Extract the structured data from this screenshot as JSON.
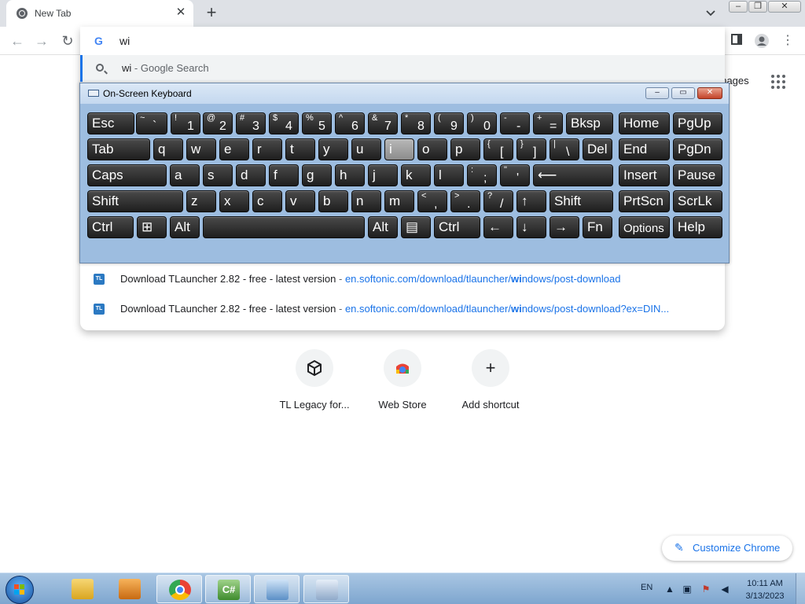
{
  "browser": {
    "tab_title": "New Tab",
    "tab_close": "✕",
    "new_tab": "+"
  },
  "omnibox": {
    "typed": "wi",
    "suggestion_query": "wi",
    "suggestion_suffix": "- Google Search",
    "results": [
      {
        "title": "Download TLauncher 2.82 - free - latest version",
        "sep": "-",
        "url_pre": "en.softonic.com/download/tlauncher/",
        "url_bold": "wi",
        "url_post": "ndows/post-download"
      },
      {
        "title": "Download TLauncher 2.82 - free - latest version",
        "sep": "-",
        "url_pre": "en.softonic.com/download/tlauncher/",
        "url_bold": "wi",
        "url_post": "ndows/post-download?ex=DIN..."
      }
    ]
  },
  "page": {
    "images_link": "Images",
    "shortcuts": [
      {
        "label": "TL Legacy for...",
        "icon": "cube-icon"
      },
      {
        "label": "Web Store",
        "icon": "web-store-icon"
      },
      {
        "label": "Add shortcut",
        "icon": "plus-icon"
      }
    ],
    "customize_label": "Customize Chrome"
  },
  "osk": {
    "title": "On-Screen Keyboard",
    "rows": [
      [
        {
          "label": "Esc"
        },
        {
          "shift": "~",
          "base": "`"
        },
        {
          "shift": "!",
          "base": "1"
        },
        {
          "shift": "@",
          "base": "2"
        },
        {
          "shift": "#",
          "base": "3"
        },
        {
          "shift": "$",
          "base": "4"
        },
        {
          "shift": "%",
          "base": "5"
        },
        {
          "shift": "^",
          "base": "6"
        },
        {
          "shift": "&",
          "base": "7"
        },
        {
          "shift": "*",
          "base": "8"
        },
        {
          "shift": "(",
          "base": "9"
        },
        {
          "shift": ")",
          "base": "0"
        },
        {
          "shift": "-",
          "base": "-"
        },
        {
          "shift": "+",
          "base": "="
        },
        {
          "label": "Bksp"
        },
        {
          "label": "Home"
        },
        {
          "label": "PgUp"
        }
      ],
      [
        {
          "label": "Tab"
        },
        {
          "label": "q"
        },
        {
          "label": "w"
        },
        {
          "label": "e"
        },
        {
          "label": "r"
        },
        {
          "label": "t"
        },
        {
          "label": "y"
        },
        {
          "label": "u"
        },
        {
          "label": "i"
        },
        {
          "label": "o"
        },
        {
          "label": "p"
        },
        {
          "shift": "{",
          "base": "["
        },
        {
          "shift": "}",
          "base": "]"
        },
        {
          "shift": "|",
          "base": "\\"
        },
        {
          "label": "Del"
        },
        {
          "label": "End"
        },
        {
          "label": "PgDn"
        }
      ],
      [
        {
          "label": "Caps"
        },
        {
          "label": "a"
        },
        {
          "label": "s"
        },
        {
          "label": "d"
        },
        {
          "label": "f"
        },
        {
          "label": "g"
        },
        {
          "label": "h"
        },
        {
          "label": "j"
        },
        {
          "label": "k"
        },
        {
          "label": "l"
        },
        {
          "shift": ":",
          "base": ";"
        },
        {
          "shift": "\"",
          "base": "'"
        },
        {
          "label": "⟵"
        },
        {
          "label": "Insert"
        },
        {
          "label": "Pause"
        }
      ],
      [
        {
          "label": "Shift"
        },
        {
          "label": "z"
        },
        {
          "label": "x"
        },
        {
          "label": "c"
        },
        {
          "label": "v"
        },
        {
          "label": "b"
        },
        {
          "label": "n"
        },
        {
          "label": "m"
        },
        {
          "shift": "<",
          "base": ","
        },
        {
          "shift": ">",
          "base": "."
        },
        {
          "shift": "?",
          "base": "/"
        },
        {
          "label": "↑"
        },
        {
          "label": "Shift"
        },
        {
          "label": "PrtScn"
        },
        {
          "label": "ScrLk"
        }
      ],
      [
        {
          "label": "Ctrl"
        },
        {
          "label": "⊞"
        },
        {
          "label": "Alt"
        },
        {
          "label": ""
        },
        {
          "label": "Alt"
        },
        {
          "label": "▤"
        },
        {
          "label": "Ctrl"
        },
        {
          "label": "←"
        },
        {
          "label": "↓"
        },
        {
          "label": "→"
        },
        {
          "label": "Fn"
        },
        {
          "label": "Options"
        },
        {
          "label": "Help"
        }
      ]
    ]
  },
  "taskbar": {
    "lang": "EN",
    "time": "10:11 AM",
    "date": "3/13/2023"
  }
}
